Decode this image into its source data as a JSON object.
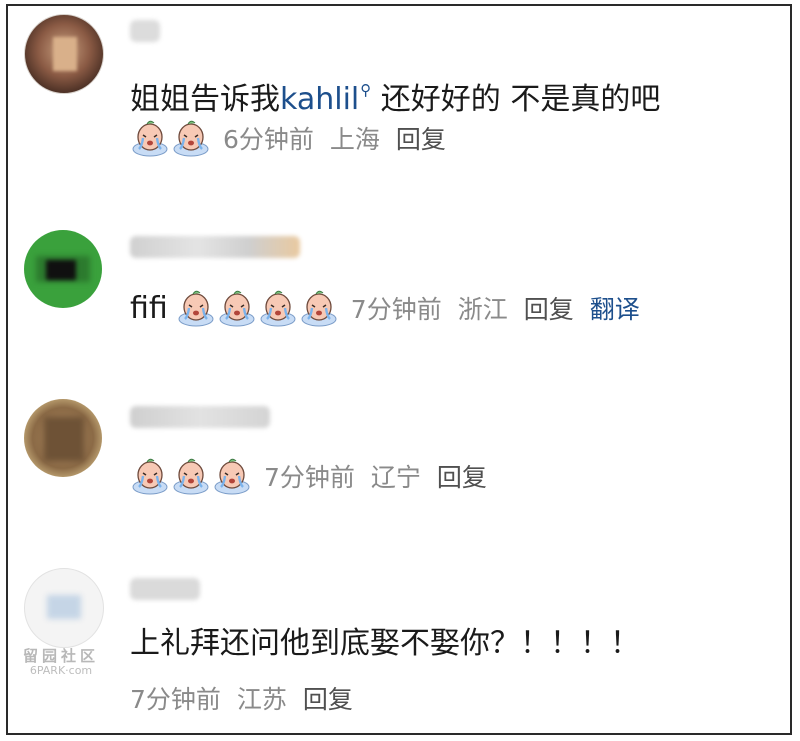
{
  "comments": [
    {
      "text_before": "姐姐告诉我",
      "mention": "kahlil",
      "text_after": " 还好好的 不是真的吧",
      "emojis": [
        "crying-face-icon",
        "crying-face-icon"
      ],
      "time": "6分钟前",
      "location": "上海",
      "reply": "回复"
    },
    {
      "prefix": "fifi",
      "emojis": [
        "crying-face-icon",
        "crying-face-icon",
        "crying-face-icon",
        "crying-face-icon"
      ],
      "time": "7分钟前",
      "location": "浙江",
      "reply": "回复",
      "translate": "翻译"
    },
    {
      "emojis": [
        "crying-face-icon",
        "crying-face-icon",
        "crying-face-icon"
      ],
      "time": "7分钟前",
      "location": "辽宁",
      "reply": "回复"
    },
    {
      "text": "上礼拜还问他到底娶不娶你？！！！！",
      "time": "7分钟前",
      "location": "江苏",
      "reply": "回复"
    }
  ],
  "watermark": {
    "line1": "留园社区",
    "line2": "6PARK·com"
  },
  "colors": {
    "link": "#1d4f8c",
    "meta": "#8a8a8a",
    "border": "#2a2a2a"
  }
}
